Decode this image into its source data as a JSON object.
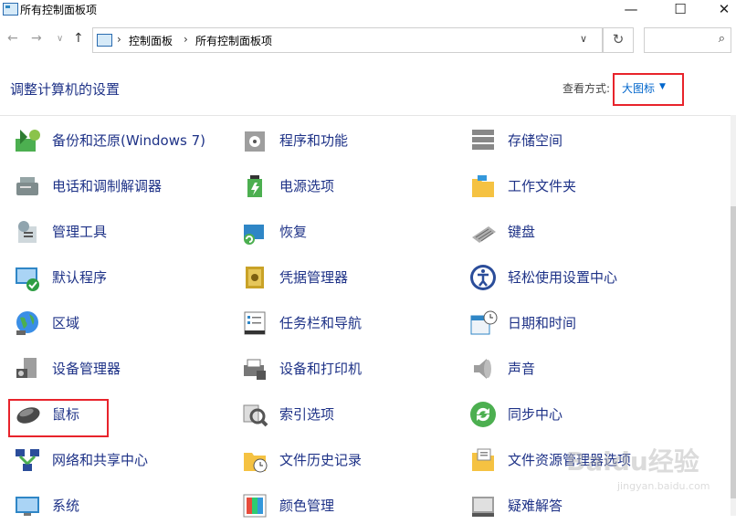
{
  "window": {
    "title": "所有控制面板项",
    "minimize": "—",
    "maximize": "☐",
    "close": "✕"
  },
  "address": {
    "back": "←",
    "forward": "→",
    "recent": "∨",
    "up": "↑",
    "crumbs": [
      "控制面板",
      "所有控制面板项"
    ],
    "separator": "›",
    "dropdown": "∨",
    "refresh": "↻",
    "search_placeholder": "",
    "search_icon": "⌕"
  },
  "header": {
    "title": "调整计算机的设置",
    "view_label": "查看方式:",
    "view_value": "大图标"
  },
  "items": [
    {
      "label": "备份和还原(Windows 7)",
      "icon": "backup-restore-icon"
    },
    {
      "label": "程序和功能",
      "icon": "programs-icon"
    },
    {
      "label": "存储空间",
      "icon": "storage-icon"
    },
    {
      "label": "电话和调制解调器",
      "icon": "phone-modem-icon"
    },
    {
      "label": "电源选项",
      "icon": "power-icon"
    },
    {
      "label": "工作文件夹",
      "icon": "work-folder-icon"
    },
    {
      "label": "管理工具",
      "icon": "admin-tools-icon"
    },
    {
      "label": "恢复",
      "icon": "recovery-icon"
    },
    {
      "label": "键盘",
      "icon": "keyboard-icon"
    },
    {
      "label": "默认程序",
      "icon": "default-programs-icon"
    },
    {
      "label": "凭据管理器",
      "icon": "credential-icon"
    },
    {
      "label": "轻松使用设置中心",
      "icon": "ease-of-access-icon"
    },
    {
      "label": "区域",
      "icon": "region-icon"
    },
    {
      "label": "任务栏和导航",
      "icon": "taskbar-icon"
    },
    {
      "label": "日期和时间",
      "icon": "datetime-icon"
    },
    {
      "label": "设备管理器",
      "icon": "device-manager-icon"
    },
    {
      "label": "设备和打印机",
      "icon": "devices-printers-icon"
    },
    {
      "label": "声音",
      "icon": "sound-icon"
    },
    {
      "label": "鼠标",
      "icon": "mouse-icon"
    },
    {
      "label": "索引选项",
      "icon": "indexing-icon"
    },
    {
      "label": "同步中心",
      "icon": "sync-icon"
    },
    {
      "label": "网络和共享中心",
      "icon": "network-icon"
    },
    {
      "label": "文件历史记录",
      "icon": "file-history-icon"
    },
    {
      "label": "文件资源管理器选项",
      "icon": "explorer-options-icon"
    },
    {
      "label": "系统",
      "icon": "system-icon"
    },
    {
      "label": "颜色管理",
      "icon": "color-management-icon"
    },
    {
      "label": "疑难解答",
      "icon": "troubleshoot-icon"
    }
  ],
  "watermark": {
    "logo": "Baidu经验",
    "sub": "jingyan.baidu.com"
  },
  "colors": {
    "link": "#1e3287",
    "highlight": "#e8232b",
    "accent": "#0066cc"
  }
}
